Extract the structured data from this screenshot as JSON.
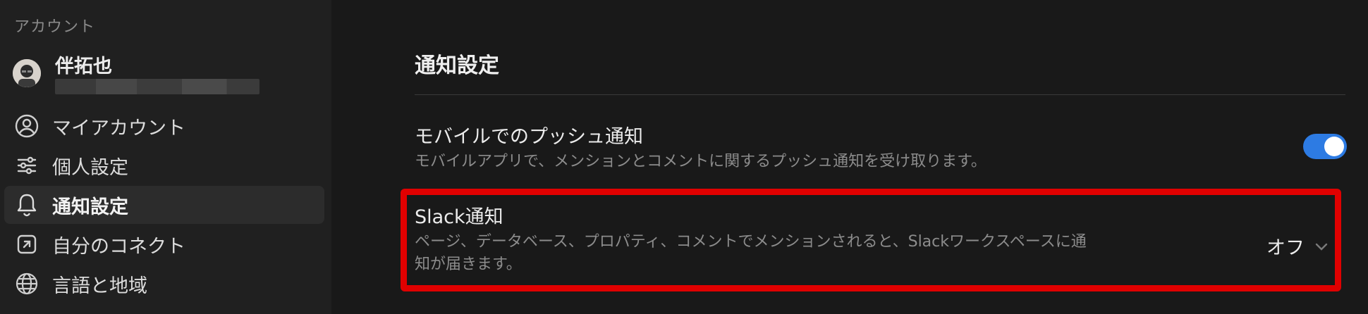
{
  "sidebar": {
    "section_label": "アカウント",
    "user": {
      "name": "伴拓也"
    },
    "items": [
      {
        "label": "マイアカウント",
        "icon": "user-circle-icon"
      },
      {
        "label": "個人設定",
        "icon": "sliders-icon"
      },
      {
        "label": "通知設定",
        "icon": "bell-icon",
        "active": true
      },
      {
        "label": "自分のコネクト",
        "icon": "external-link-icon"
      },
      {
        "label": "言語と地域",
        "icon": "globe-icon"
      }
    ]
  },
  "main": {
    "title": "通知設定",
    "settings": [
      {
        "title": "モバイルでのプッシュ通知",
        "description": "モバイルアプリで、メンションとコメントに関するプッシュ通知を受け取ります。",
        "control": "toggle",
        "enabled": true
      },
      {
        "title": "Slack通知",
        "description_line1": "ページ、データベース、プロパティ、コメントでメンションされると、Slackワークスペースに通",
        "description_line2": "知が届きます。",
        "control": "select",
        "value": "オフ"
      }
    ]
  },
  "colors": {
    "toggle_on": "#2d7be3",
    "highlight": "#e00000"
  }
}
